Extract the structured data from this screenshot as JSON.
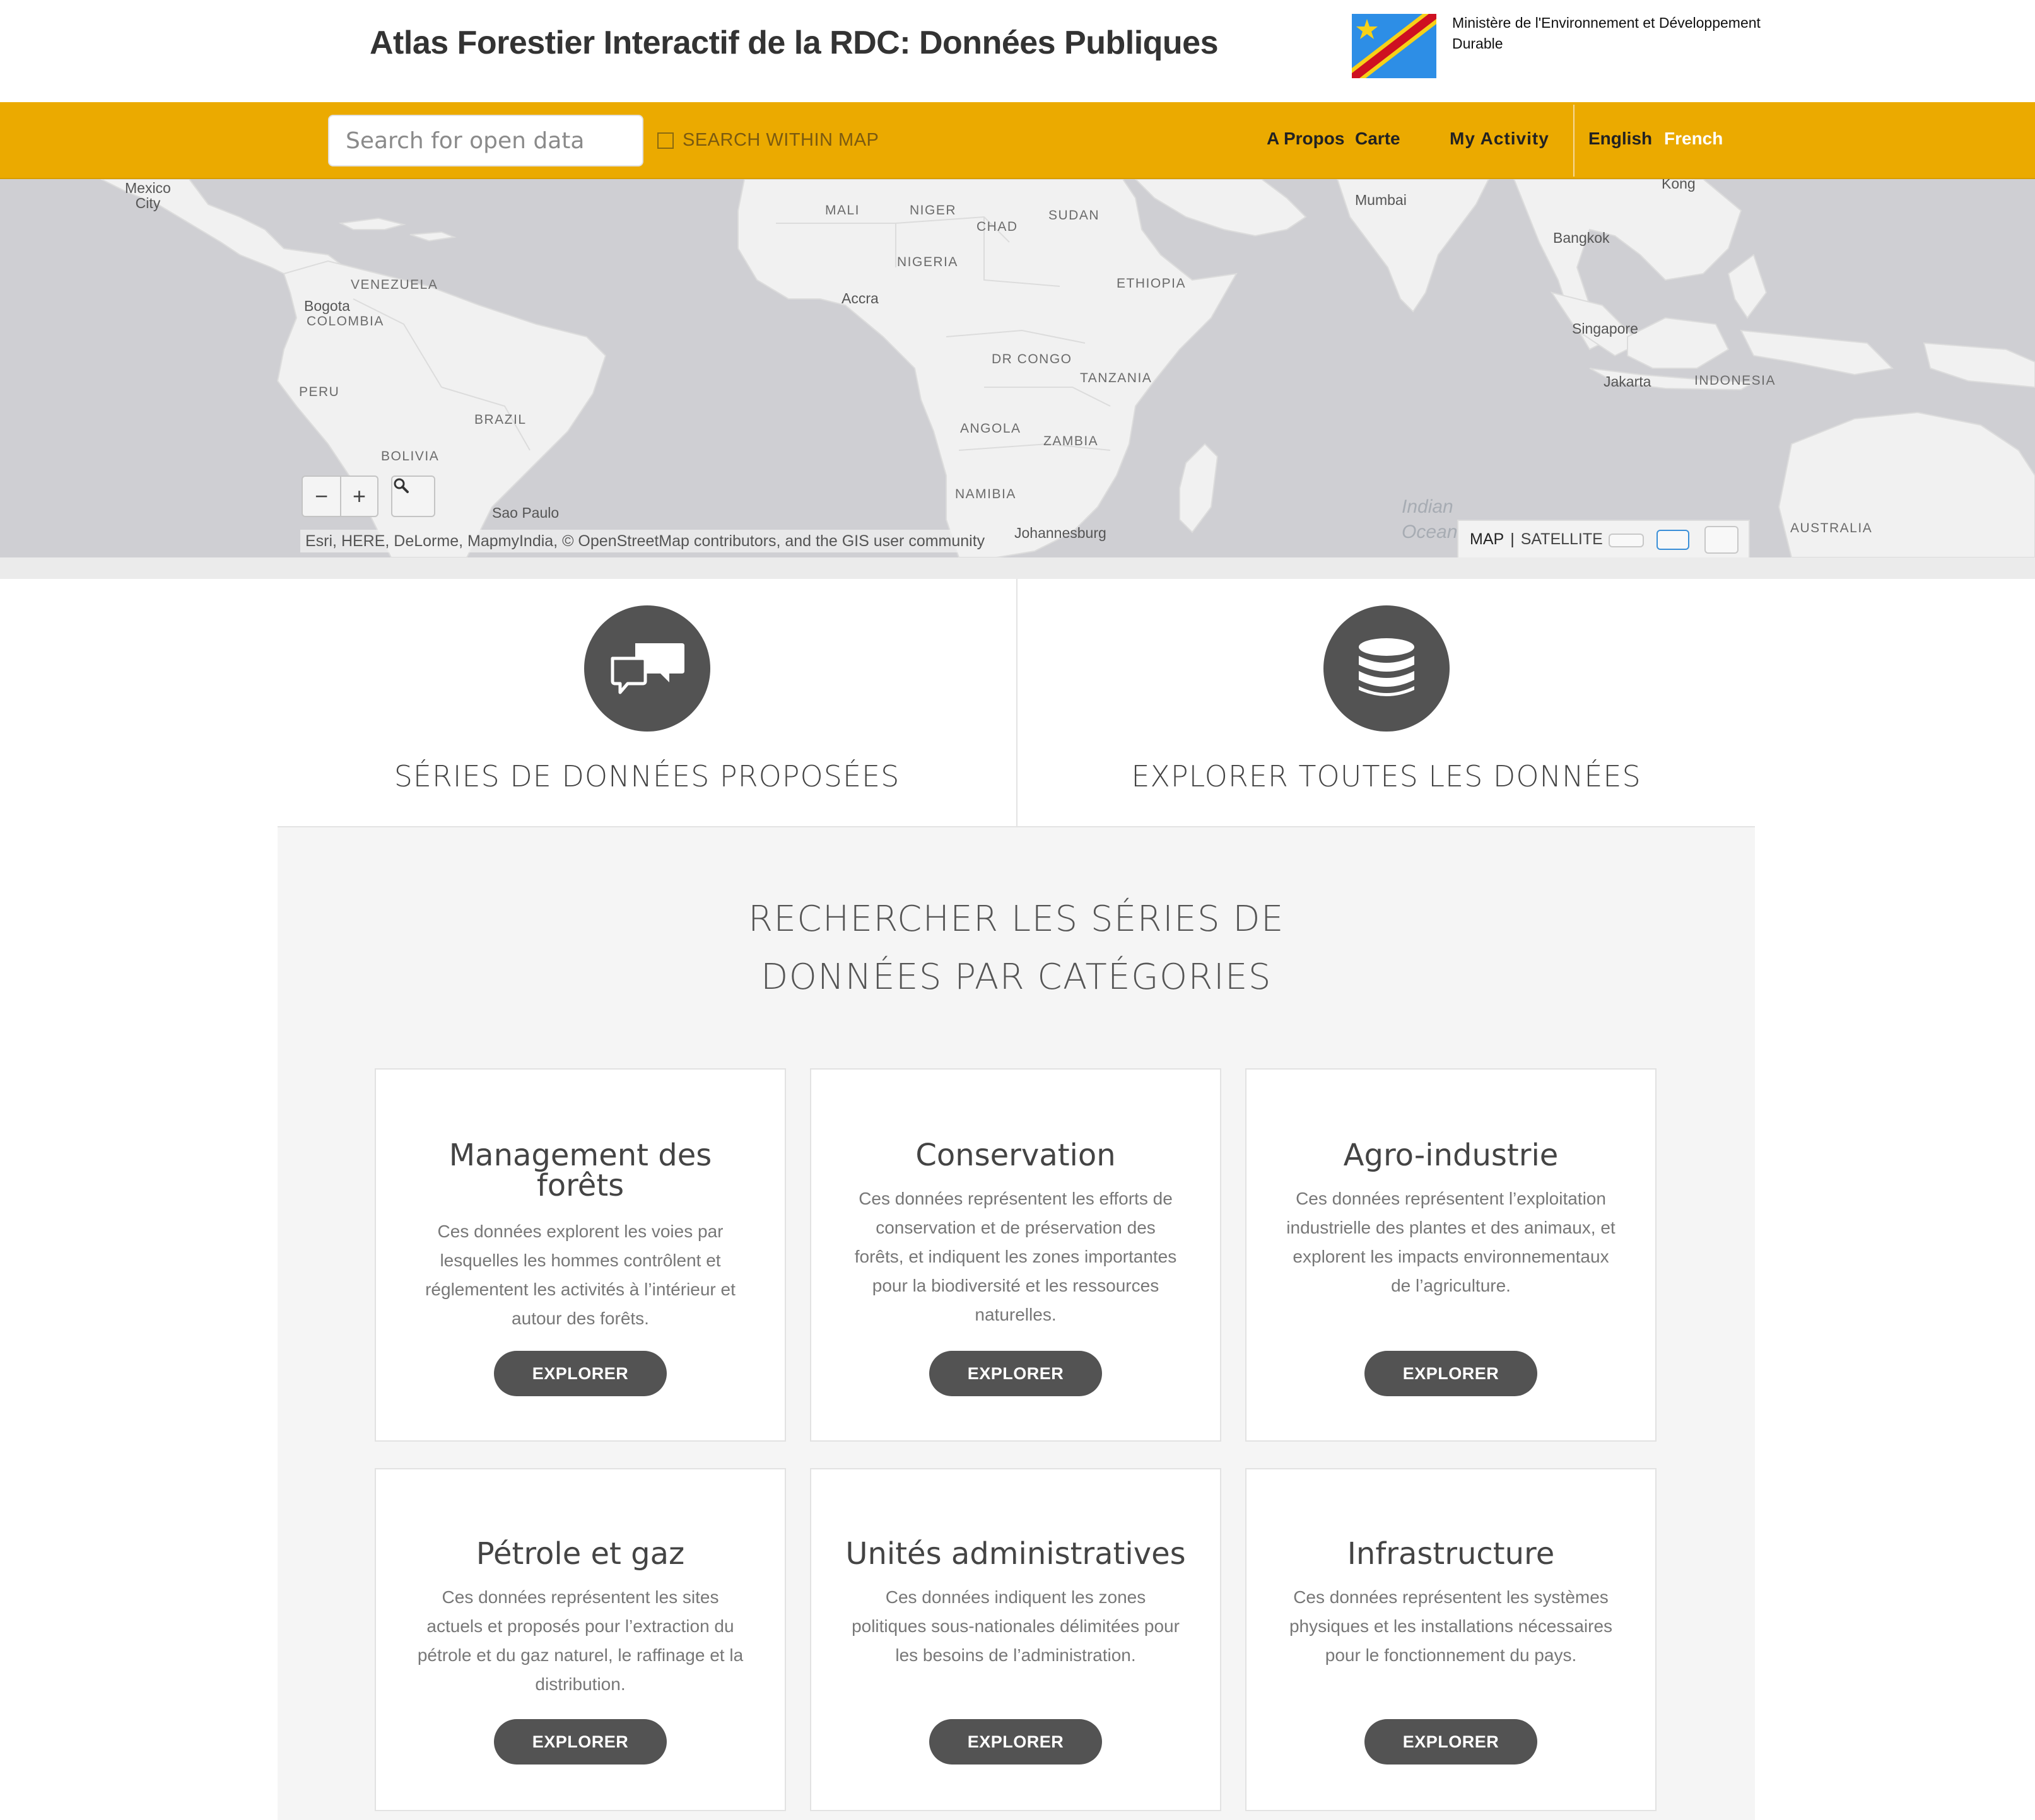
{
  "header": {
    "title": "Atlas Forestier Interactif de la RDC: Données Publiques",
    "ministry": "Ministère de l'Environnement et Développement Durable"
  },
  "nav": {
    "search_placeholder": "Search for open data",
    "search_within_map": "SEARCH WITHIN MAP",
    "links": {
      "about": "A Propos",
      "map": "Carte",
      "my_activity": "My Activity",
      "english": "English",
      "french": "French"
    }
  },
  "map": {
    "labels": {
      "mexico_city": "Mexico\nCity",
      "mali": "MALI",
      "niger": "NIGER",
      "chad": "CHAD",
      "sudan": "SUDAN",
      "mumbai": "Mumbai",
      "kong": "Kong",
      "bangkok": "Bangkok",
      "venezuela": "VENEZUELA",
      "nigeria": "NIGERIA",
      "ethiopia": "ETHIOPIA",
      "bogota": "Bogota",
      "colombia": "COLOMBIA",
      "accra": "Accra",
      "singapore": "Singapore",
      "dr_congo": "DR CONGO",
      "tanzania": "TANZANIA",
      "jakarta": "Jakarta",
      "indonesia": "INDONESIA",
      "peru": "PERU",
      "brazil": "BRAZIL",
      "angola": "ANGOLA",
      "zambia": "ZAMBIA",
      "bolivia": "BOLIVIA",
      "namibia": "NAMIBIA",
      "sao_paulo": "Sao Paulo",
      "johannesburg": "Johannesburg",
      "indian_ocean": "Indian\nOcean",
      "australia": "AUSTRALIA"
    },
    "attribution": "Esri, HERE, DeLorme, MapmyIndia, © OpenStreetMap contributors, and the GIS user community",
    "basemap_map": "MAP",
    "basemap_sep": "|",
    "basemap_satellite": "SATELLITE",
    "zoom_out": "−",
    "zoom_in": "+"
  },
  "features": {
    "featured": "SÉRIES DE DONNÉES PROPOSÉES",
    "explore_all": "EXPLORER TOUTES LES DONNÉES"
  },
  "categories": {
    "heading_line1": "RECHERCHER LES SÉRIES DE",
    "heading_line2": "DONNÉES PAR CATÉGORIES",
    "items": [
      {
        "title": "Management des forêts",
        "description": "Ces données explorent les voies par lesquelles les hommes contrôlent et réglementent les activités à l’intérieur et autour des forêts.",
        "button": "EXPLORER"
      },
      {
        "title": "Conservation",
        "description": "Ces données représentent les efforts de conservation et de préservation des forêts, et indiquent les zones importantes pour la biodiversité et les ressources naturelles.",
        "button": "EXPLORER"
      },
      {
        "title": "Agro-industrie",
        "description": "Ces données représentent l’exploitation industrielle des plantes et des animaux, et explorent les impacts environnementaux de l’agriculture.",
        "button": "EXPLORER"
      },
      {
        "title": "Pétrole et gaz",
        "description": "Ces données représentent les sites actuels et proposés pour l’extraction du pétrole et du gaz naturel, le raffinage et la distribution.",
        "button": "EXPLORER"
      },
      {
        "title": "Unités administratives",
        "description": "Ces données indiquent les zones politiques sous-nationales délimitées pour les besoins de l’administration.",
        "button": "EXPLORER"
      },
      {
        "title": "Infrastructure",
        "description": "Ces données représentent les systèmes physiques et les installations nécessaires pour le fonctionnement du pays.",
        "button": "EXPLORER"
      }
    ]
  },
  "colors": {
    "nav_bar": "#ebaa00",
    "nav_active_lang": "#ffffff",
    "dark_button": "#535353",
    "land": "#f1f1f1",
    "water": "#cfcfd3"
  },
  "icons": {
    "featured": "chat-bubbles-icon",
    "explore_all": "database-icon",
    "map_search": "magnifier-icon"
  }
}
